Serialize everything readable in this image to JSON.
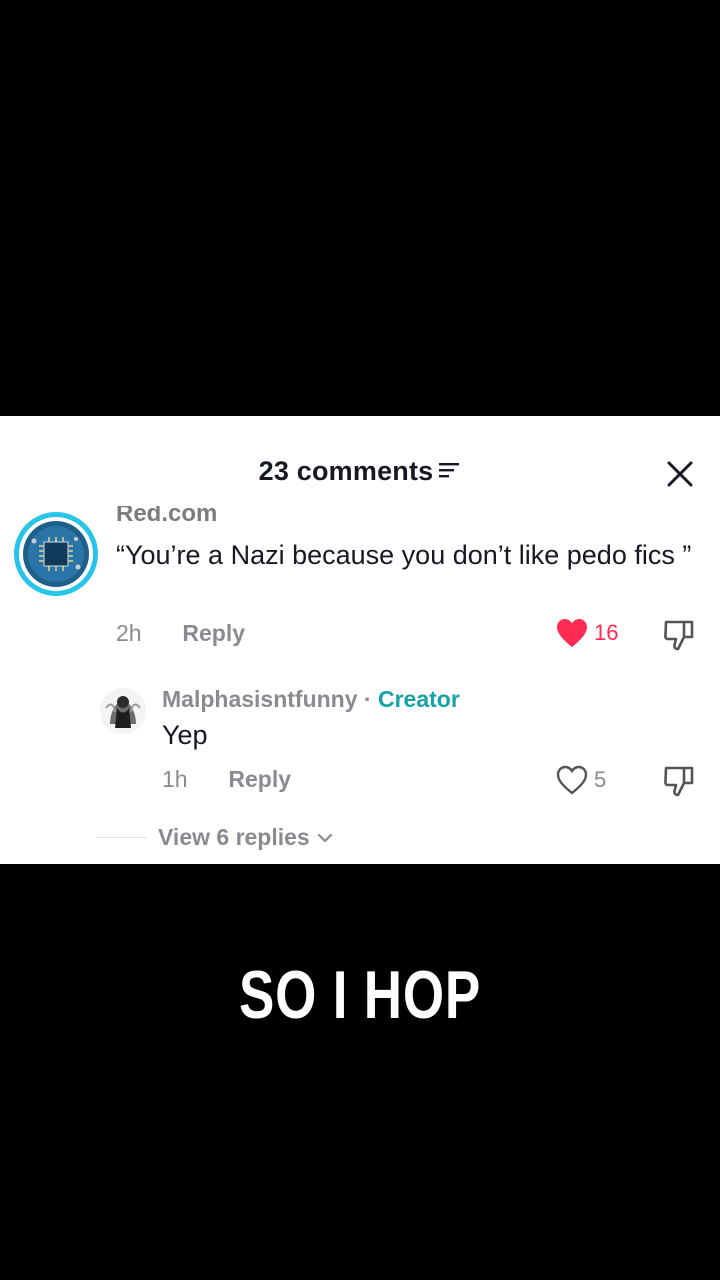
{
  "header": {
    "title": "23 comments"
  },
  "comments": [
    {
      "username": "Red.com",
      "text": "“You’re a Nazi because you don’t like pedo fics ”",
      "time": "2h",
      "reply_label": "Reply",
      "likes": "16",
      "liked": true
    }
  ],
  "reply": {
    "username": "Malphasisntfunny",
    "separator": " · ",
    "badge": "Creator",
    "text": "Yep",
    "time": "1h",
    "reply_label": "Reply",
    "likes": "5",
    "liked": false
  },
  "view_replies": {
    "label": "View 6 replies"
  },
  "video": {
    "caption": "SO I HOP"
  },
  "colors": {
    "like_active": "#fe2c55",
    "creator": "#17a2a7",
    "avatar_ring": "#27c5e8"
  }
}
